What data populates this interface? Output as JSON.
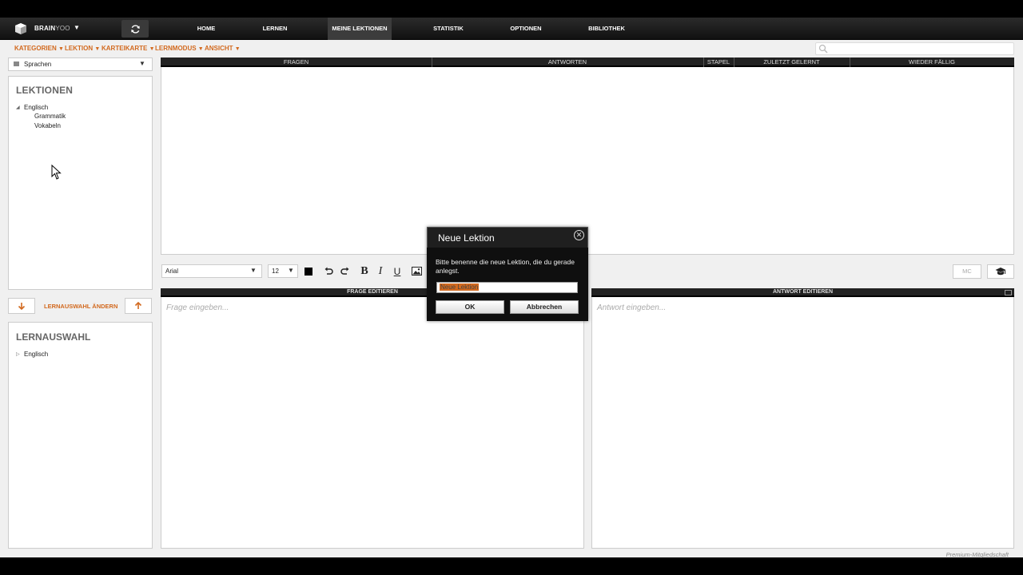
{
  "app": {
    "brand_bold": "BRAIN",
    "brand_light": "YOO"
  },
  "nav": {
    "items": [
      "HOME",
      "LERNEN",
      "MEINE LEKTIONEN",
      "STATISTIK",
      "OPTIONEN",
      "BIBLIOTHEK"
    ],
    "active": "MEINE LEKTIONEN"
  },
  "menu": {
    "items": [
      "KATEGORIEN",
      "LEKTION",
      "KARTEIKARTE",
      "LERNMODUS",
      "ANSICHT"
    ]
  },
  "search": {
    "placeholder": ""
  },
  "sidebar": {
    "category_select": "Sprachen",
    "lektionen_title": "LEKTIONEN",
    "tree": {
      "root": "Englisch",
      "children": [
        "Grammatik",
        "Vokabeln"
      ]
    },
    "lernauswahl_change": "LERNAUSWAHL ÄNDERN",
    "lernauswahl_title": "LERNAUSWAHL",
    "lernauswahl_tree": {
      "root": "Englisch"
    }
  },
  "table": {
    "columns": [
      "FRAGEN",
      "ANTWORTEN",
      "STAPEL",
      "ZULETZT GELERNT",
      "WIEDER FÄLLIG"
    ]
  },
  "toolbar": {
    "font": "Arial",
    "size": "12",
    "bold": "B",
    "italic": "I",
    "underline": "U",
    "mc": "MC"
  },
  "editors": {
    "frage_title": "FRAGE EDITIEREN",
    "frage_placeholder": "Frage eingeben...",
    "antwort_title": "ANTWORT EDITIEREN",
    "antwort_placeholder": "Antwort eingeben..."
  },
  "dialog": {
    "title": "Neue Lektion",
    "message": "Bitte benenne die neue Lektion, die du gerade anlegst.",
    "input_value": "Neue Lektion",
    "ok": "OK",
    "cancel": "Abbrechen"
  },
  "footer": {
    "membership": "Premium-Mitgliedschaft"
  },
  "colors": {
    "accent": "#d2691e",
    "topbar": "#1a1a1a",
    "panel_bg": "#ffffff"
  }
}
